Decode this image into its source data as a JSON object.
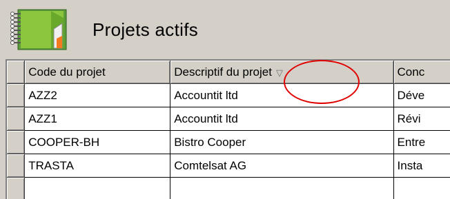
{
  "header": {
    "title": "Projets actifs",
    "icon": "notebook-icon"
  },
  "grid": {
    "columns": [
      {
        "label": "Code du projet"
      },
      {
        "label": "Descriptif du projet",
        "sort_icon": "▽"
      },
      {
        "label": "Conc"
      }
    ],
    "rows": [
      {
        "code": "AZZ2",
        "desc": "Accountit ltd",
        "third": "Déve"
      },
      {
        "code": "AZZ1",
        "desc": "Accountit ltd",
        "third": "Révi"
      },
      {
        "code": "COOPER-BH",
        "desc": "Bistro Cooper",
        "third": "Entre"
      },
      {
        "code": "TRASTA",
        "desc": "Comtelsat AG",
        "third": "Insta"
      }
    ]
  },
  "annotation": {
    "color": "#e00000"
  }
}
